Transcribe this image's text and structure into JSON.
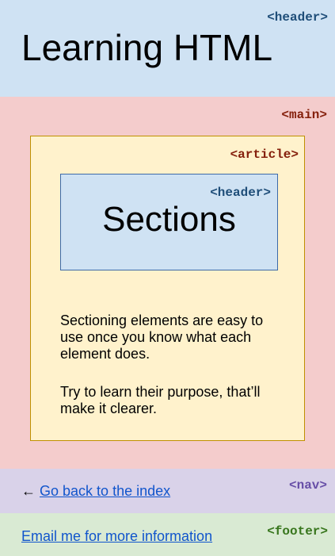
{
  "page_header": {
    "tag_label": "<header>",
    "title": "Learning HTML",
    "color": "#cfe2f3"
  },
  "main": {
    "tag_label": "<main>",
    "color": "#f4cccc",
    "article": {
      "tag_label": "<article>",
      "color": "#fff2cc",
      "header": {
        "tag_label": "<header>",
        "title": "Sections"
      },
      "paragraphs": [
        "Sectioning elements are easy to use once you know what each element does.",
        "Try to learn their purpose, that’ll make it clearer."
      ]
    }
  },
  "nav": {
    "tag_label": "<nav>",
    "arrow": "←",
    "link_text": "Go back to the index",
    "color": "#d9d2e9"
  },
  "footer": {
    "tag_label": "<footer>",
    "link_text": "Email me for more information",
    "color": "#d9ead3"
  },
  "colors": {
    "header_tag": "#1f4e79",
    "main_tag": "#85200c",
    "nav_tag": "#674ea7",
    "footer_tag": "#38761d",
    "link": "#1155cc"
  }
}
